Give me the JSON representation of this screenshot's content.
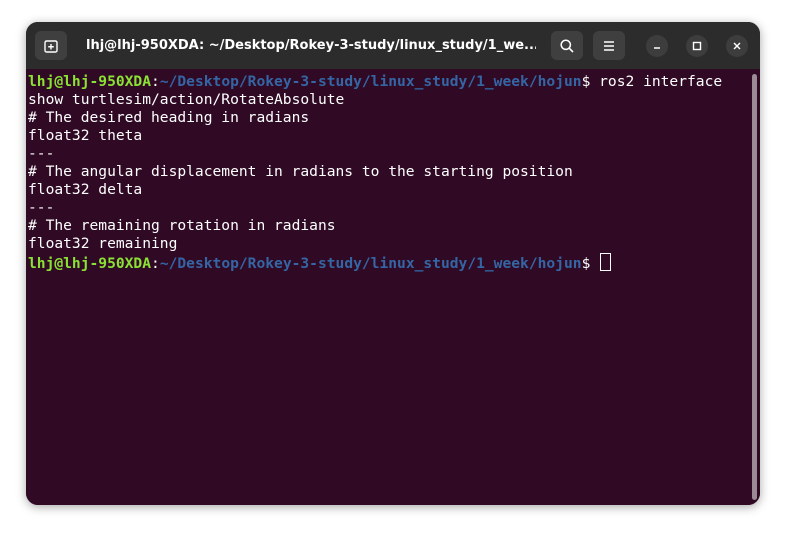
{
  "window": {
    "title": "lhj@lhj-950XDA: ~/Desktop/Rokey-3-study/linux_study/1_we..."
  },
  "icons": {
    "new_tab": "new-tab-icon",
    "search": "search-icon",
    "menu": "hamburger-menu-icon",
    "minimize": "minimize-icon",
    "maximize": "maximize-icon",
    "close": "close-icon"
  },
  "terminal": {
    "prompt_user": "lhj@lhj-950XDA",
    "prompt_colon": ":",
    "prompt_path": "~/Desktop/Rokey-3-study/linux_study/1_week/hojun",
    "prompt_symbol": "$ ",
    "command_part1": "ros2 interface",
    "command_part2": "show turtlesim/action/RotateAbsolute",
    "output": [
      "# The desired heading in radians",
      "float32 theta",
      "---",
      "# The angular displacement in radians to the starting position",
      "float32 delta",
      "---",
      "# The remaining rotation in radians",
      "float32 remaining"
    ]
  },
  "colors": {
    "terminal_bg": "#300a24",
    "titlebar_bg": "#2c2c2c",
    "prompt_user": "#8ae234",
    "prompt_path": "#3465a4"
  }
}
